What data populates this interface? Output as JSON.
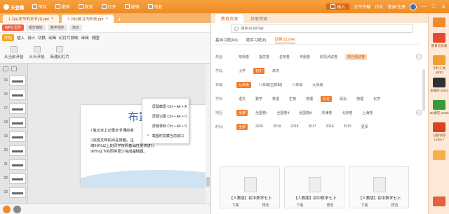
{
  "titlebar": {
    "app_label": "天登幕",
    "items": [
      "保存",
      "撤销",
      "恢复",
      "打开",
      "撤销",
      "恢复"
    ],
    "tab_label": "插入",
    "file_label": "文件传输",
    "work_label": "作业",
    "user_label": "登录/注册"
  },
  "doc_tabs": [
    {
      "label": "1.2(a)本节的本节(1).ppt"
    },
    {
      "label": "1.2(b)复习内外测.ppt"
    }
  ],
  "ribbon": {
    "row1": [
      "WPS 文件",
      "报告模板",
      "教学课件",
      "演示"
    ],
    "menus": [
      "开始",
      "插入",
      "设计",
      "切换",
      "动画",
      "幻灯片放映",
      "审阅",
      "视图"
    ],
    "active_menu": "开始",
    "tools": [
      "从当前开始",
      "从头开始",
      "新建幻灯片"
    ]
  },
  "slides": {
    "numbers": [
      "15",
      "16",
      "17",
      "18",
      "19",
      "20",
      "21",
      "22",
      "23"
    ],
    "selected": "18"
  },
  "slide": {
    "title": "布置作业",
    "line1_red": "1",
    "line1": "笔记本上记录本节课的收",
    "line2_red": "2",
    "line2": "完成文档的点在效题。注",
    "line3": "绩90%以上的同学按照基础性要求进行",
    "line4": "90%以下的同学至少完成基础题。"
  },
  "context_menu": {
    "items": [
      {
        "label": "屏幕截图 Ctrl + Alt + A",
        "checked": false
      },
      {
        "label": "屏幕识图 Ctrl + Alt + O",
        "checked": false
      },
      {
        "label": "屏幕录制 Ctrl + Alt + S",
        "checked": false
      },
      {
        "label": "截图时隐藏当前窗口",
        "checked": true
      }
    ]
  },
  "library": {
    "tabs": [
      "教育资源",
      "共享资源"
    ],
    "active_tab": "教育资源",
    "search_placeholder": "搜索资源内容",
    "subtabs": [
      "基础习题(84)",
      "题库习题(8)",
      "试卷(11264)"
    ],
    "active_subtab": "试卷(11264)",
    "filters": [
      {
        "label": "类型:",
        "options": [
          "常规卷",
          "提优卷",
          "名校卷",
          "专题卷",
          "阶段测试卷",
          "单元测试卷"
        ],
        "active": "单元测试卷"
      },
      {
        "label": "学段:",
        "options": [
          "小学",
          "初中",
          "高中"
        ],
        "active": "初中"
      },
      {
        "label": "年级:",
        "options": [
          "七年级",
          "八年级(五四制)",
          "八年级",
          "九年级"
        ],
        "active": "七年级"
      },
      {
        "label": "学科:",
        "options": [
          "语文",
          "数学",
          "英语",
          "生物",
          "地理",
          "历史",
          "政治",
          "物理",
          "化学"
        ],
        "active": "数学"
      },
      {
        "label": "地区:",
        "options": [
          "全部",
          "全国卷Ⅰ",
          "全国卷Ⅱ",
          "全国卷Ⅲ",
          "天津卷",
          "北京卷",
          "上海卷"
        ],
        "active": "全部"
      },
      {
        "label": "时间:",
        "options": [
          "全部",
          "2020",
          "2019",
          "2018",
          "2017",
          "2016",
          "2015",
          "更早"
        ],
        "active": "全部"
      }
    ],
    "cards": [
      {
        "title": "【人教版】初中数学七上",
        "download": "下载",
        "preview": "预览"
      },
      {
        "title": "【人教版】初中数学七上",
        "download": "下载",
        "preview": "预览"
      },
      {
        "title": "【人教版】初中数学七上",
        "download": "下载",
        "preview": "预览"
      }
    ]
  },
  "right_sidebar": [
    {
      "label": "",
      "color": "#f08a2a"
    },
    {
      "label": "教育云资源",
      "color": "#e64a2e"
    },
    {
      "label": "学科工具 45/93",
      "color": "#f0a030"
    },
    {
      "label": "多媒体 20/33",
      "color": "#303030"
    },
    {
      "label": "3D课堂 22/66",
      "color": "#3a9a3a"
    },
    {
      "label": "习题/试卷 135/6.7",
      "color": "#d8431e"
    },
    {
      "label": "",
      "color": "#f5b04a"
    },
    {
      "label": "",
      "color": "#e06040"
    }
  ],
  "colors": {
    "accent": "#f08a2a",
    "slide_title": "#3c6fb0"
  }
}
